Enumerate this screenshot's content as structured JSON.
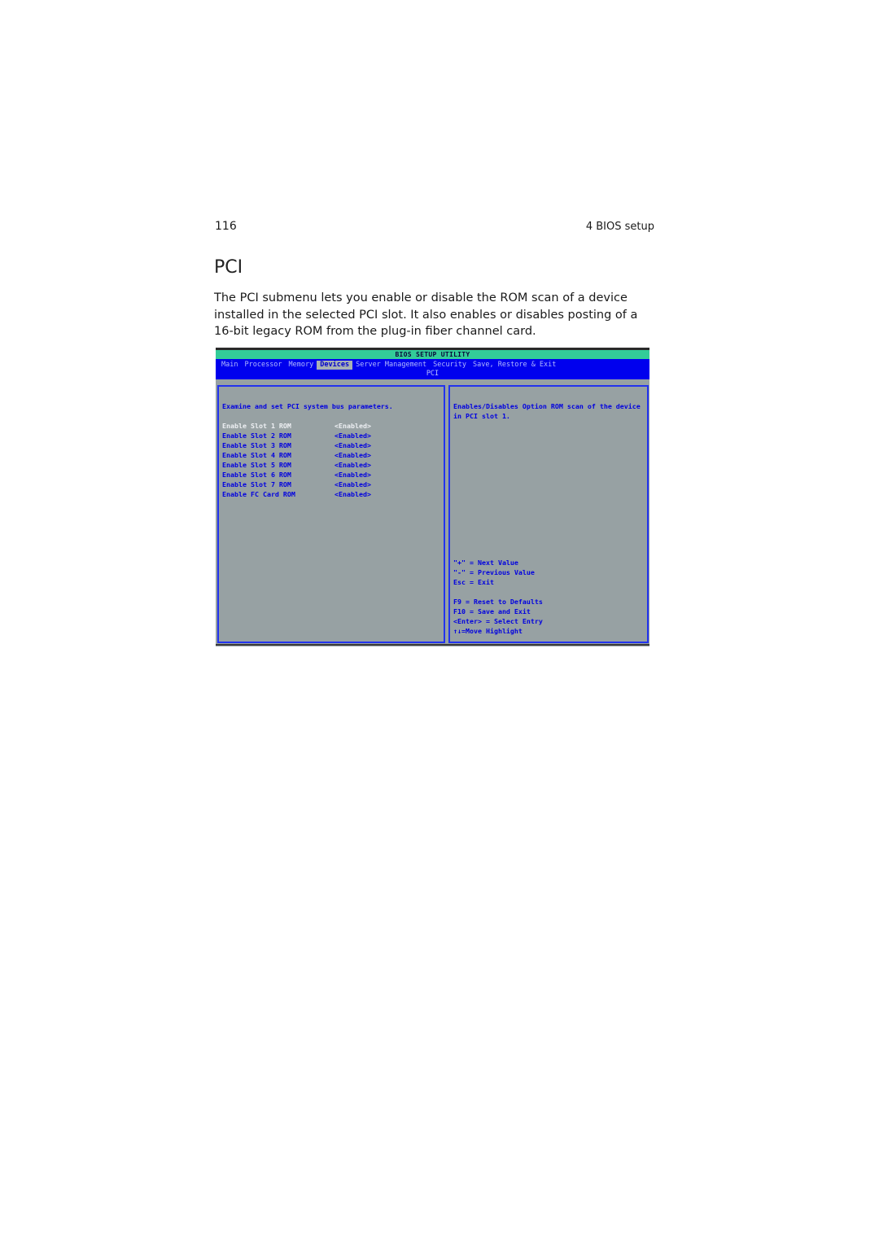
{
  "page": {
    "number": "116",
    "chapter": "4 BIOS setup",
    "section_title": "PCI",
    "intro": "The PCI submenu lets you enable or disable the ROM scan of a device installed in the selected PCI slot. It also enables or disables posting of a 16-bit legacy ROM from the plug-in fiber channel card."
  },
  "bios": {
    "title": "BIOS SETUP UTILITY",
    "menu": [
      {
        "label": "Main",
        "active": false
      },
      {
        "label": "Processor",
        "active": false
      },
      {
        "label": "Memory",
        "active": false
      },
      {
        "label": "Devices",
        "active": true
      },
      {
        "label": "Server Management",
        "active": false
      },
      {
        "label": "Security",
        "active": false
      },
      {
        "label": "Save, Restore & Exit",
        "active": false
      }
    ],
    "subtitle": "PCI",
    "left_description": "Examine and set PCI system bus parameters.",
    "items": [
      {
        "label": "Enable Slot 1 ROM",
        "value": "<Enabled>",
        "selected": true
      },
      {
        "label": "Enable Slot 2 ROM",
        "value": "<Enabled>",
        "selected": false
      },
      {
        "label": "Enable Slot 3 ROM",
        "value": "<Enabled>",
        "selected": false
      },
      {
        "label": "Enable Slot 4 ROM",
        "value": "<Enabled>",
        "selected": false
      },
      {
        "label": "Enable Slot 5 ROM",
        "value": "<Enabled>",
        "selected": false
      },
      {
        "label": "Enable Slot 6 ROM",
        "value": "<Enabled>",
        "selected": false
      },
      {
        "label": "Enable Slot 7 ROM",
        "value": "<Enabled>",
        "selected": false
      },
      {
        "label": "Enable FC Card ROM",
        "value": "<Enabled>",
        "selected": false
      }
    ],
    "help_text": "Enables/Disables Option ROM scan of the device in PCI slot 1.",
    "keys_group1": [
      "\"+\" = Next Value",
      "\"-\" = Previous Value",
      "Esc = Exit"
    ],
    "keys_group2": [
      "F9 = Reset to Defaults",
      "F10 = Save and Exit",
      "<Enter> = Select Entry",
      "↑↓=Move Highlight"
    ],
    "colors": {
      "title_bar": "#33cc99",
      "menu_bar": "#0000ee",
      "panel_bg": "#97a1a3",
      "text": "#0000e0",
      "selected_text": "#eef0f4"
    }
  }
}
